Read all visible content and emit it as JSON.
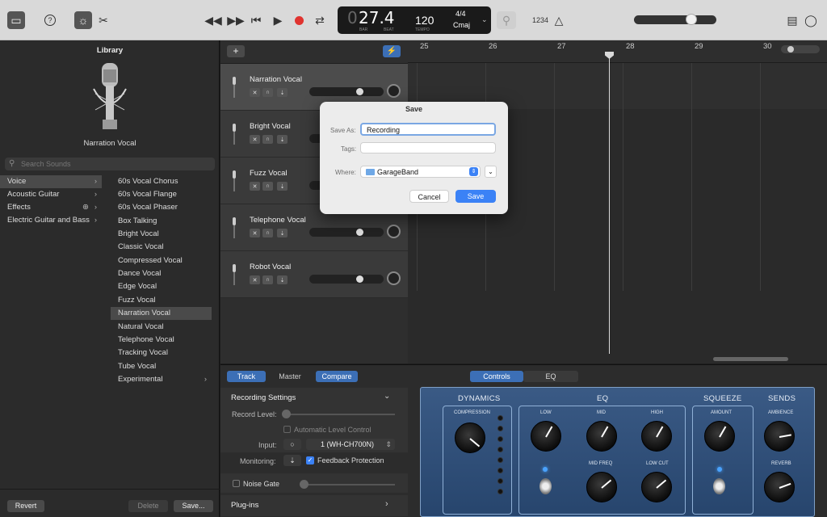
{
  "toolbar": {
    "lcd": {
      "position": "27.4",
      "bar_label": "BAR",
      "beat_label": "BEAT",
      "tempo": "120",
      "tempo_label": "TEMPO",
      "signature": "4/4",
      "key": "Cmaj"
    },
    "count_in": "1234",
    "help_icon": "?"
  },
  "library": {
    "title": "Library",
    "patch_name": "Narration Vocal",
    "search_placeholder": "Search Sounds",
    "categories": [
      {
        "label": "Voice",
        "selected": true
      },
      {
        "label": "Acoustic Guitar"
      },
      {
        "label": "Effects"
      },
      {
        "label": "Electric Guitar and Bass"
      }
    ],
    "items": [
      "60s Vocal Chorus",
      "60s Vocal Flange",
      "60s Vocal Phaser",
      "Box Talking",
      "Bright Vocal",
      "Classic Vocal",
      "Compressed Vocal",
      "Dance Vocal",
      "Edge Vocal",
      "Fuzz Vocal",
      "Narration Vocal",
      "Natural Vocal",
      "Telephone Vocal",
      "Tracking Vocal",
      "Tube Vocal",
      "Experimental"
    ],
    "selected_item": "Narration Vocal",
    "revert_label": "Revert",
    "delete_label": "Delete",
    "save_label": "Save..."
  },
  "tracks": [
    {
      "name": "Narration Vocal",
      "volume": 0.7
    },
    {
      "name": "Bright Vocal",
      "volume": 0.7
    },
    {
      "name": "Fuzz Vocal",
      "volume": 0.7
    },
    {
      "name": "Telephone Vocal",
      "volume": 0.7
    },
    {
      "name": "Robot Vocal",
      "volume": 0.7
    }
  ],
  "timeline": {
    "bars": [
      "25",
      "26",
      "27",
      "28",
      "29",
      "30"
    ]
  },
  "save_dialog": {
    "title": "Save",
    "save_as_label": "Save As:",
    "save_as_value": "Recording",
    "tags_label": "Tags:",
    "tags_value": "",
    "where_label": "Where:",
    "where_value": "GarageBand",
    "cancel_label": "Cancel",
    "save_label": "Save"
  },
  "smart_controls": {
    "tabs_left": [
      "Track",
      "Master",
      "Compare"
    ],
    "tabs_right": [
      "Controls",
      "EQ"
    ],
    "recording_settings": "Recording Settings",
    "record_level_label": "Record Level:",
    "auto_level_label": "Automatic Level Control",
    "input_label": "Input:",
    "input_value": "1 (WH-CH700N)",
    "monitoring_label": "Monitoring:",
    "feedback_label": "Feedback Protection",
    "noise_gate_label": "Noise Gate",
    "plugins_label": "Plug-ins"
  },
  "amp": {
    "sections": [
      "DYNAMICS",
      "EQ",
      "SQUEEZE",
      "SENDS"
    ],
    "labels": {
      "compression": "COMPRESSION",
      "low": "LOW",
      "mid": "MID",
      "high": "HIGH",
      "mid_freq": "MID FREQ",
      "low_cut": "LOW CUT",
      "amount": "AMOUNT",
      "ambience": "AMBIENCE",
      "reverb": "REVERB"
    }
  },
  "colors": {
    "accent": "#3c6fb6",
    "record": "#e0332f",
    "dialog_bg": "#ececec"
  }
}
